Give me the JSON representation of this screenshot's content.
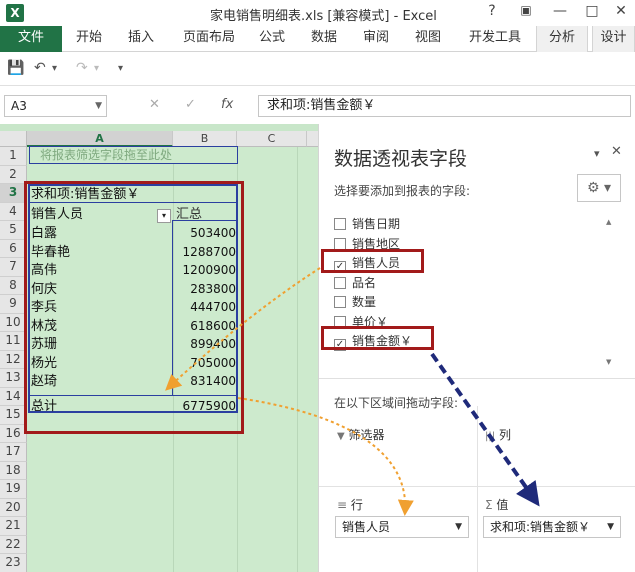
{
  "window": {
    "logo": "X",
    "title": "家电销售明细表.xls  [兼容模式] - Excel",
    "help": "?",
    "restore": "▣",
    "minimize": "—",
    "maximize": "□",
    "close": "✕"
  },
  "ribbon": {
    "file": "文件",
    "tabs": [
      "开始",
      "插入",
      "页面布局",
      "公式",
      "数据",
      "审阅",
      "视图",
      "开发工具",
      "分析",
      "设计"
    ]
  },
  "qat": {
    "save": "💾",
    "undo": "↶",
    "undo_dd": "▾",
    "redo": "↷",
    "redo_dd": "▾",
    "customize": "▾"
  },
  "formula_bar": {
    "name_box": "A3",
    "cancel": "✕",
    "enter": "✓",
    "fx": "fx",
    "formula": "求和项:销售金额￥"
  },
  "sheet": {
    "columns": [
      "A",
      "B",
      "C"
    ],
    "rows": [
      "1",
      "2",
      "3",
      "4",
      "5",
      "6",
      "7",
      "8",
      "9",
      "10",
      "11",
      "12",
      "13",
      "14",
      "15",
      "16",
      "17",
      "18",
      "19",
      "20",
      "21",
      "22",
      "23"
    ],
    "filter_drop_text": "将报表筛选字段拖至此处",
    "header_value": "求和项:销售金额￥",
    "row_label_header": "销售人员",
    "sum_header": "汇总",
    "filter_button": "▾",
    "data": [
      {
        "name": "白露",
        "value": "503400"
      },
      {
        "name": "毕春艳",
        "value": "1288700"
      },
      {
        "name": "高伟",
        "value": "1200900"
      },
      {
        "name": "何庆",
        "value": "283800"
      },
      {
        "name": "李兵",
        "value": "444700"
      },
      {
        "name": "林茂",
        "value": "618600"
      },
      {
        "name": "苏珊",
        "value": "899400"
      },
      {
        "name": "杨光",
        "value": "705000"
      },
      {
        "name": "赵琦",
        "value": "831400"
      }
    ],
    "total_label": "总计",
    "total_value": "6775900"
  },
  "panel": {
    "title": "数据透视表字段",
    "dropdown": "▾",
    "close": "✕",
    "subtitle": "选择要添加到报表的字段:",
    "gear": "⚙ ▾",
    "fields": [
      {
        "label": "销售日期",
        "checked": false
      },
      {
        "label": "销售地区",
        "checked": false
      },
      {
        "label": "销售人员",
        "checked": true
      },
      {
        "label": "品名",
        "checked": false
      },
      {
        "label": "数量",
        "checked": false
      },
      {
        "label": "单价￥",
        "checked": false
      },
      {
        "label": "销售金额￥",
        "checked": true
      }
    ],
    "check_mark": "✓",
    "scroll_up": "▲",
    "scroll_down": "▼",
    "drag_hint": "在以下区域间拖动字段:",
    "areas": {
      "filters": {
        "icon": "▼",
        "label": "筛选器"
      },
      "columns": {
        "icon": "|||",
        "label": "列"
      },
      "rows": {
        "icon": "≡",
        "label": "行",
        "value": "销售人员"
      },
      "values": {
        "icon": "Σ",
        "label": "值",
        "value": "求和项:销售金额￥"
      }
    },
    "area_dd": "▼"
  },
  "colors": {
    "excel_green": "#217346",
    "sheet_green": "#cdeacd",
    "highlight_red": "#a21a1a",
    "pivot_blue": "#2b3fa0",
    "arrow_orange": "#f0a030",
    "arrow_navy": "#1f2a7a"
  }
}
